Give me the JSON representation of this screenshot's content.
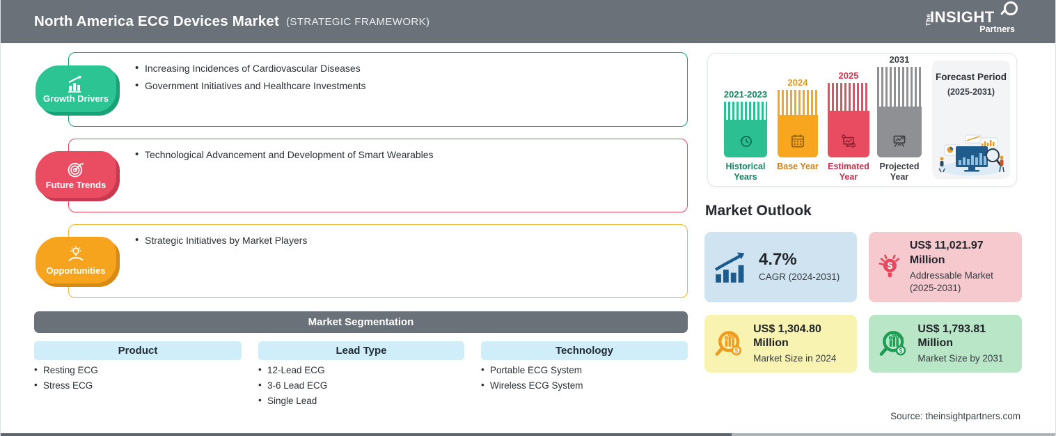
{
  "header": {
    "title": "North America ECG Devices Market",
    "subtitle": "(STRATEGIC FRAMEWORK)",
    "logo": {
      "line1": "The",
      "line2": "INSIGHT",
      "line3": "Partners"
    }
  },
  "framework": [
    {
      "label": "Growth Drivers",
      "icon": "growth-chart-icon",
      "color": "#2cc493",
      "border": "#0da06f",
      "items": [
        "Increasing Incidences of Cardiovascular Diseases",
        "Government Initiatives and Healthcare Investments"
      ]
    },
    {
      "label": "Future Trends",
      "icon": "target-dart-icon",
      "color": "#ea4c62",
      "border": "#e8475d",
      "items": [
        "Technological Advancement and Development of Smart Wearables"
      ]
    },
    {
      "label": "Opportunities",
      "icon": "hand-bulb-icon",
      "color": "#f6a41e",
      "border": "#f2b327",
      "items": [
        "Strategic Initiatives by Market Players"
      ]
    }
  ],
  "segmentation": {
    "title": "Market Segmentation",
    "columns": [
      {
        "header": "Product",
        "items": [
          "Resting ECG",
          "Stress ECG"
        ]
      },
      {
        "header": "Lead Type",
        "items": [
          "12-Lead ECG",
          "3-6 Lead ECG",
          "Single Lead"
        ]
      },
      {
        "header": "Technology",
        "items": [
          "Portable ECG System",
          "Wireless ECG System"
        ]
      }
    ]
  },
  "timeline": {
    "bars": [
      {
        "year": "2021-2023",
        "label": "Historical Years",
        "color": "#2bbf92",
        "icon": "history-clock-icon"
      },
      {
        "year": "2024",
        "label": "Base Year",
        "color": "#f8a61f",
        "icon": "calendar-icon"
      },
      {
        "year": "2025",
        "label": "Estimated Year",
        "color": "#e94b60",
        "icon": "estimate-monitor-icon"
      },
      {
        "year": "2031",
        "label": "Projected Year",
        "color": "#8e9093",
        "icon": "projector-screen-icon"
      }
    ],
    "forecast": {
      "title": "Forecast Period",
      "range": "(2025-2031)",
      "icon": "analytics-illustration"
    }
  },
  "outlook": {
    "title": "Market Outlook",
    "cards": [
      {
        "value": "4.7%",
        "label": "CAGR (2024-2031)",
        "bg": "#cfe4f0",
        "accent": "#1c5b8e",
        "icon": "cagr-growth-icon"
      },
      {
        "value": "US$ 11,021.97 Million",
        "label": "Addressable Market (2025-2031)",
        "bg": "#f5c9cd",
        "accent": "#e8485e",
        "icon": "bulb-dollar-icon"
      },
      {
        "value": "US$ 1,304.80 Million",
        "label": "Market Size in 2024",
        "bg": "#f8f3b0",
        "accent": "#f09b1d",
        "icon": "magnifier-chart-orange-icon"
      },
      {
        "value": "US$ 1,793.81 Million",
        "label": "Market Size by 2031",
        "bg": "#b9e6c6",
        "accent": "#1f9d55",
        "icon": "magnifier-chart-green-icon"
      }
    ]
  },
  "footer": {
    "source": "Source: theinsightpartners.com"
  }
}
